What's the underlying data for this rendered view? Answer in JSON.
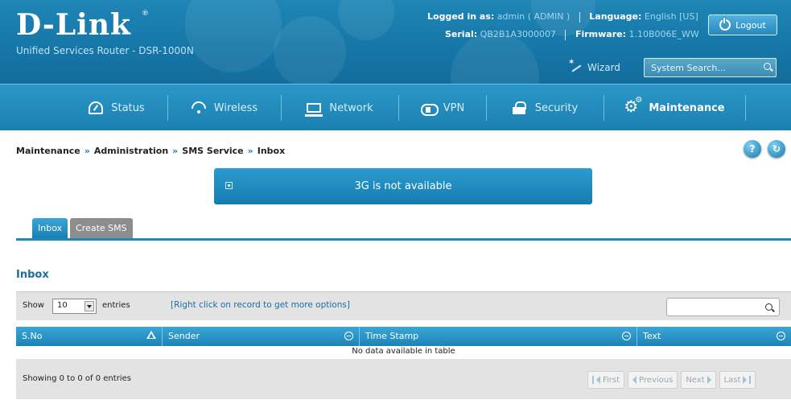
{
  "brand": {
    "logo": "D-Link",
    "subtitle": "Unified Services Router - DSR-1000N"
  },
  "header": {
    "logged_label": "Logged in as:",
    "logged_value": "admin ( ADMIN )",
    "language_label": "Language:",
    "language_value": "English [US]",
    "serial_label": "Serial:",
    "serial_value": "QB2B1A3000007",
    "firmware_label": "Firmware:",
    "firmware_value": "1.10B006E_WW",
    "logout": "Logout",
    "wizard": "Wizard",
    "search_placeholder": "System Search..."
  },
  "nav": {
    "items": [
      {
        "label": "Status",
        "icon": "dashboard-icon"
      },
      {
        "label": "Wireless",
        "icon": "wifi-icon"
      },
      {
        "label": "Network",
        "icon": "monitor-icon"
      },
      {
        "label": "VPN",
        "icon": "cloud-lock-icon"
      },
      {
        "label": "Security",
        "icon": "lock-icon"
      },
      {
        "label": "Maintenance",
        "icon": "gears-icon",
        "active": true
      }
    ]
  },
  "breadcrumb": [
    "Maintenance",
    "Administration",
    "SMS Service",
    "Inbox"
  ],
  "breadcrumb_sep": "»",
  "help": {
    "help": "?",
    "refresh": "↻"
  },
  "alert": {
    "message": "3G is not available"
  },
  "tabs": [
    {
      "label": "Inbox",
      "active": true
    },
    {
      "label": "Create SMS",
      "active": false
    }
  ],
  "table": {
    "title": "Inbox",
    "show_label": "Show",
    "page_size": "10",
    "entries_label": "entries",
    "hint": "[Right click on record to get more options]",
    "columns": [
      "S.No",
      "Sender",
      "Time Stamp",
      "Text"
    ],
    "empty_message": "No data available in table",
    "info": "Showing 0 to 0 of 0 entries",
    "pager": {
      "first": "First",
      "previous": "Previous",
      "next": "Next",
      "last": "Last"
    }
  },
  "colors": {
    "accent": "#1f86b6",
    "nav": "#1c80b1",
    "tab_active": "#2a95c8",
    "tab_inactive": "#8d8d8d"
  }
}
